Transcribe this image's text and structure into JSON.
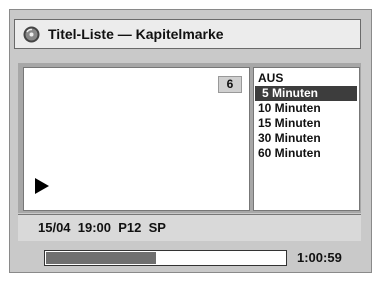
{
  "header": {
    "title": "Titel-Liste — Kapitelmarke",
    "icon": "disc-icon"
  },
  "preview": {
    "chapter_number": "6",
    "play_icon": "play-icon"
  },
  "options": {
    "items": [
      "AUS",
      "5 Minuten",
      "10 Minuten",
      "15 Minuten",
      "30 Minuten",
      "60 Minuten"
    ],
    "selected": "5 Minuten"
  },
  "info": {
    "text": "15/04  19:00  P12  SP"
  },
  "playback": {
    "progress_fraction": 0.46,
    "time": "1:00:59"
  },
  "colors": {
    "frame": "#c9c9c9",
    "panel": "#a7a7a7",
    "selected_bg": "#3d3d3d",
    "progress_fill": "#6f6f6f"
  }
}
